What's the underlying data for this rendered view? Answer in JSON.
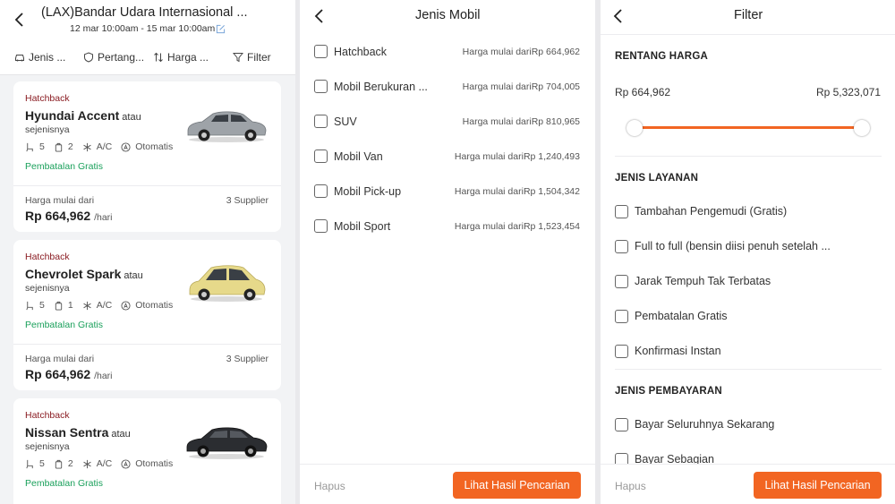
{
  "results": {
    "title": "(LAX)Bandar Udara Internasional ...",
    "dates": "12 mar 10:00am - 15 mar 10:00am",
    "filters": [
      "Jenis ...",
      "Pertang...",
      "Harga ...",
      "Filter"
    ],
    "cards": [
      {
        "category": "Hatchback",
        "name": "Hyundai Accent",
        "suffix": "atau",
        "sejenis": "sejenisnya",
        "seats": "5",
        "bags": "2",
        "ac": "A/C",
        "transmission": "Otomatis",
        "cancel": "Pembatalan Gratis",
        "from_label": "Harga mulai dari",
        "price": "Rp 664,962",
        "per": "/hari",
        "suppliers": "3 Supplier",
        "car_color": "#9ea3a8"
      },
      {
        "category": "Hatchback",
        "name": "Chevrolet Spark",
        "suffix": "atau",
        "sejenis": "sejenisnya",
        "seats": "5",
        "bags": "1",
        "ac": "A/C",
        "transmission": "Otomatis",
        "cancel": "Pembatalan Gratis",
        "from_label": "Harga mulai dari",
        "price": "Rp 664,962",
        "per": "/hari",
        "suppliers": "3 Supplier",
        "car_color": "#e6d98a"
      },
      {
        "category": "Hatchback",
        "name": "Nissan Sentra",
        "suffix": "atau",
        "sejenis": "sejenisnya",
        "seats": "5",
        "bags": "2",
        "ac": "A/C",
        "transmission": "Otomatis",
        "cancel": "Pembatalan Gratis",
        "car_color": "#2b2d31"
      }
    ]
  },
  "car_type": {
    "title": "Jenis Mobil",
    "items": [
      {
        "label": "Hatchback",
        "price": "Harga mulai dariRp 664,962"
      },
      {
        "label": "Mobil Berukuran ...",
        "price": "Harga mulai dariRp 704,005"
      },
      {
        "label": "SUV",
        "price": "Harga mulai dariRp 810,965"
      },
      {
        "label": "Mobil Van",
        "price": "Harga mulai dariRp 1,240,493"
      },
      {
        "label": "Mobil Pick-up",
        "price": "Harga mulai dariRp 1,504,342"
      },
      {
        "label": "Mobil Sport",
        "price": "Harga mulai dariRp 1,523,454"
      }
    ],
    "clear": "Hapus",
    "apply": "Lihat Hasil Pencarian"
  },
  "filter": {
    "title": "Filter",
    "price_range": {
      "heading": "RENTANG HARGA",
      "min": "Rp 664,962",
      "max": "Rp 5,323,071"
    },
    "service": {
      "heading": "JENIS LAYANAN",
      "items": [
        "Tambahan Pengemudi (Gratis)",
        "Full to full (bensin diisi penuh setelah ...",
        "Jarak Tempuh Tak Terbatas",
        "Pembatalan Gratis",
        "Konfirmasi Instan"
      ]
    },
    "payment": {
      "heading": "JENIS PEMBAYARAN",
      "items": [
        "Bayar Seluruhnya Sekarang",
        "Bayar Sebagian"
      ]
    },
    "clear": "Hapus",
    "apply": "Lihat Hasil Pencarian"
  },
  "colors": {
    "accent": "#f26522",
    "category": "#8a1c22",
    "gratis": "#1aa05b"
  }
}
